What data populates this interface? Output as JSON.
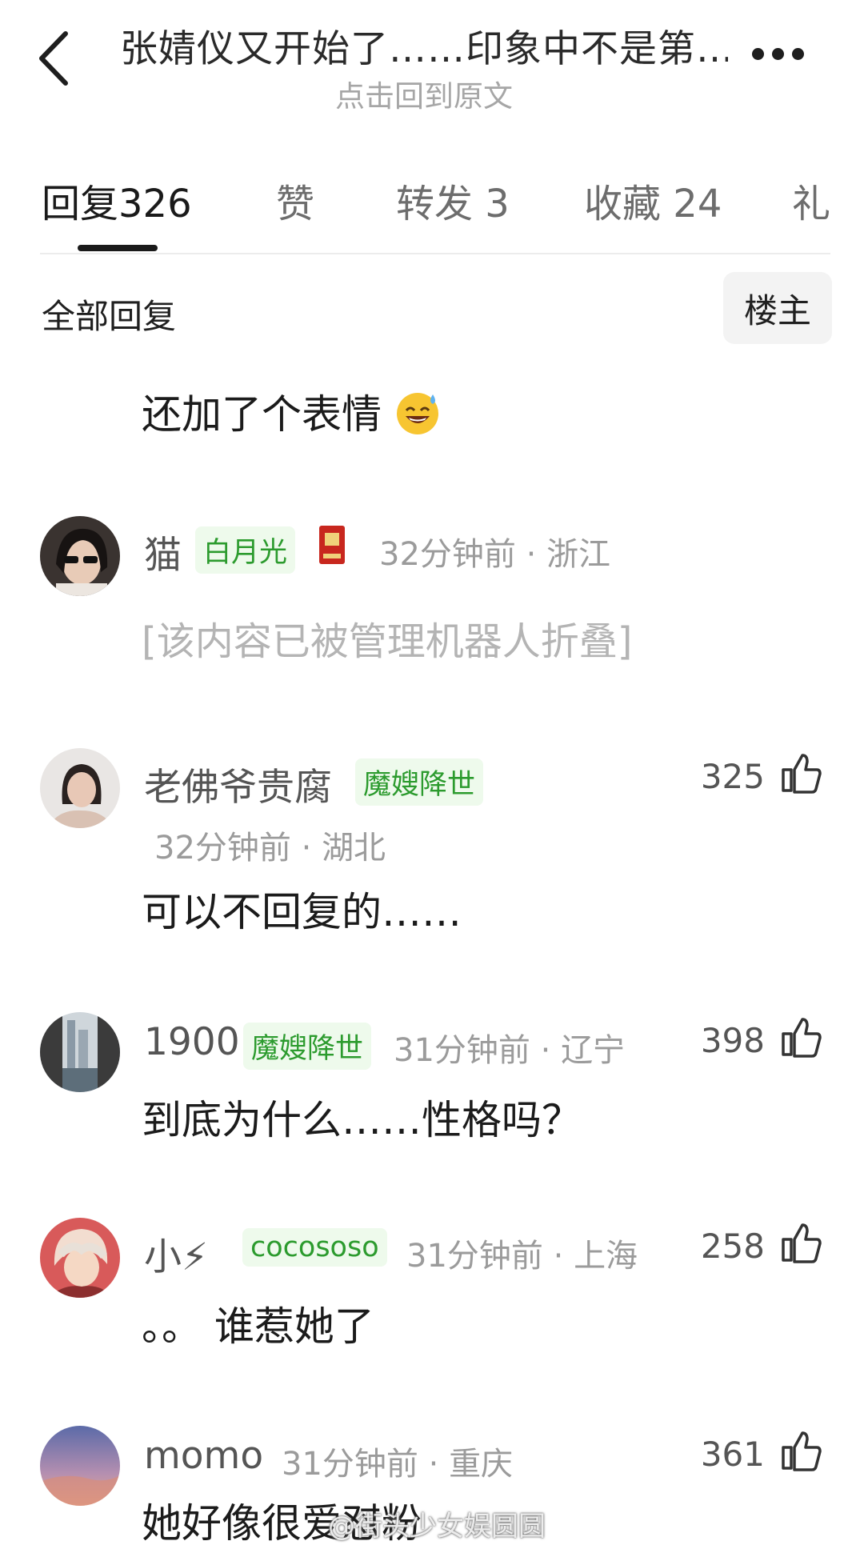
{
  "header": {
    "title": "张婧仪又开始了……印象中不是第…",
    "subtitle": "点击回到原文"
  },
  "tabs": [
    {
      "label": "回复",
      "count": "326"
    },
    {
      "label": "赞",
      "count": ""
    },
    {
      "label": "转发",
      "count": "3"
    },
    {
      "label": "收藏",
      "count": "24"
    },
    {
      "label": "礼",
      "count": ""
    }
  ],
  "filter": {
    "all_label": "全部回复",
    "owner_label": "楼主"
  },
  "partial_comment": {
    "text": "还加了个表情"
  },
  "comments": [
    {
      "username": "猫",
      "badge": "白月光",
      "time": "32分钟前",
      "location": "浙江",
      "text": "[该内容已被管理机器人折叠]",
      "likes": ""
    },
    {
      "username": "老佛爷贵腐",
      "badge": "魔嫂降世",
      "time": "32分钟前",
      "location": "湖北",
      "text": "可以不回复的……",
      "likes": "325"
    },
    {
      "username": "1900",
      "badge": "魔嫂降世",
      "time": "31分钟前",
      "location": "辽宁",
      "text": "到底为什么……性格吗？",
      "likes": "398"
    },
    {
      "username": "小⚡",
      "badge": "cocososo",
      "time": "31分钟前",
      "location": "上海",
      "text": "。。 谁惹她了",
      "likes": "258"
    },
    {
      "username": "momo",
      "badge": "",
      "time": "31分钟前",
      "location": "重庆",
      "text": "她好像很爱怼粉",
      "likes": "361"
    }
  ],
  "watermark": "@街头少女娱圆圆",
  "colors": {
    "badge_green": "#2c9b2e",
    "badge_bg": "#eefaec",
    "folded_gray": "#b4b4b4",
    "meta_gray": "#9b9b9b"
  },
  "icons": [
    "back-icon",
    "more-icon",
    "like-icon",
    "red-envelope-icon",
    "sweat-smile-emoji"
  ]
}
